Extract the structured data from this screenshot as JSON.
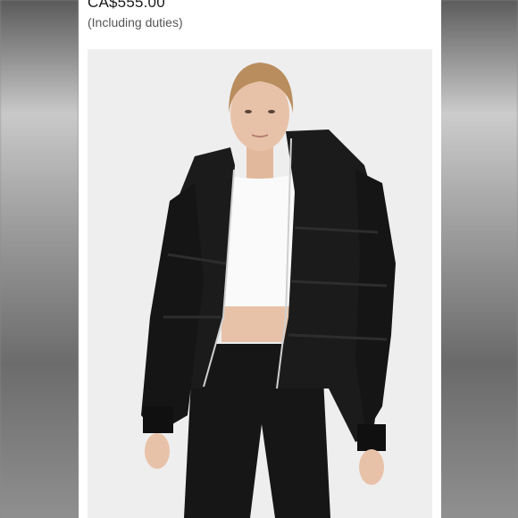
{
  "product": {
    "price": "CA$555.00",
    "duties_note": "(Including duties)"
  },
  "image": {
    "subject": "black leather puffer jacket worn with white crop top and black trousers",
    "background_color": "#eeeeee",
    "jacket_color": "#1b1b1b",
    "top_color": "#fafafa",
    "pants_color": "#161616",
    "skin_color": "#e8c2a8",
    "hair_color": "#b98d5e"
  }
}
